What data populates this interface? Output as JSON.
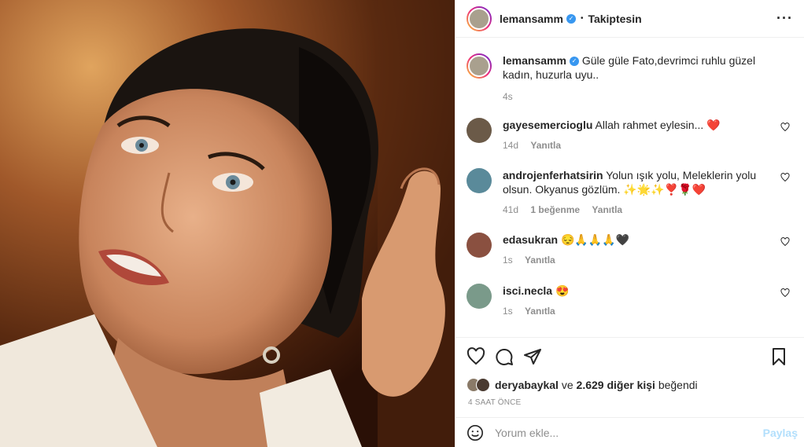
{
  "post": {
    "image_alt": "Photo of a smiling woman with dark hair looking upward"
  },
  "header": {
    "username": "lemansamm",
    "verified": true,
    "separator": "•",
    "follow_status": "Takiptesin",
    "more_icon": "more-horizontal-icon"
  },
  "caption": {
    "username": "lemansamm",
    "text": "Güle güle Fato,devrimci ruhlu güzel kadın, huzurla uyu..",
    "time": "4s"
  },
  "comments": [
    {
      "username": "gayesemercioglu",
      "text": "Allah rahmet eylesin... ❤️",
      "time": "14d",
      "likes": "",
      "reply": "Yanıtla",
      "avatar_color": "#6b5a48"
    },
    {
      "username": "androjenferhatsirin",
      "text": "Yolun ışık yolu, Meleklerin yolu olsun. Okyanus gözlüm. ✨🌟✨❣️🌹❤️",
      "time": "41d",
      "likes": "1 beğenme",
      "reply": "Yanıtla",
      "avatar_color": "#5a8a9a"
    },
    {
      "username": "edasukran",
      "text": "😔🙏🙏🙏🖤",
      "time": "1s",
      "likes": "",
      "reply": "Yanıtla",
      "avatar_color": "#8a5040"
    },
    {
      "username": "isci.necla",
      "text": "😍",
      "time": "1s",
      "likes": "",
      "reply": "Yanıtla",
      "avatar_color": "#7a9a8a"
    }
  ],
  "actions": {
    "like_icon": "heart-icon",
    "comment_icon": "comment-icon",
    "share_icon": "share-icon",
    "save_icon": "bookmark-icon"
  },
  "likes": {
    "liker": "deryabaykal",
    "connector": "ve",
    "others": "2.629 diğer kişi",
    "suffix": "beğendi"
  },
  "timestamp": "4 SAAT ÖNCE",
  "add_comment": {
    "placeholder": "Yorum ekle...",
    "post_label": "Paylaş",
    "emoji_icon": "emoji-icon"
  },
  "colors": {
    "accent": "#0095f6",
    "post_disabled": "#b2dffc",
    "heart_red": "#ed4956",
    "verified": "#3897f0",
    "muted": "#8e8e8e"
  }
}
